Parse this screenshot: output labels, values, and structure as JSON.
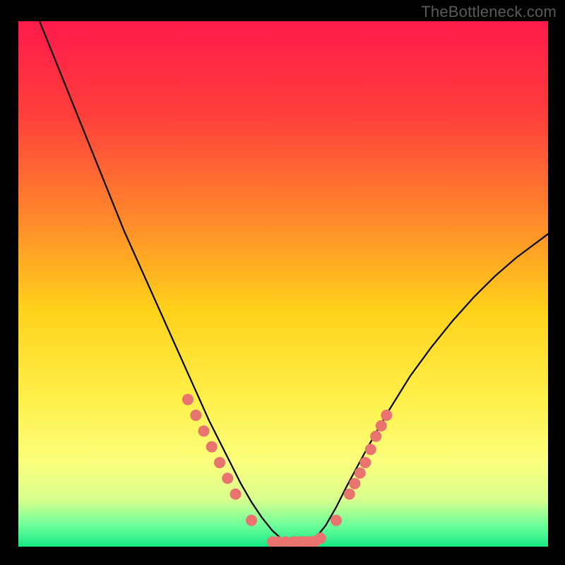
{
  "watermark": "TheBottleneck.com",
  "chart_data": {
    "type": "line",
    "title": "",
    "xlabel": "",
    "ylabel": "",
    "xlim": [
      0,
      100
    ],
    "ylim": [
      0,
      100
    ],
    "gradient_stops": [
      {
        "offset": 0,
        "color": "#ff1a4b"
      },
      {
        "offset": 18,
        "color": "#ff3f3c"
      },
      {
        "offset": 38,
        "color": "#ff8a2a"
      },
      {
        "offset": 55,
        "color": "#ffd21a"
      },
      {
        "offset": 72,
        "color": "#fff04a"
      },
      {
        "offset": 84,
        "color": "#fbff7d"
      },
      {
        "offset": 91,
        "color": "#d8ff8c"
      },
      {
        "offset": 96,
        "color": "#6cff9a"
      },
      {
        "offset": 100,
        "color": "#17e884"
      }
    ],
    "series": [
      {
        "name": "bottleneck-curve",
        "x": [
          0,
          4,
          8,
          12,
          16,
          20,
          24,
          28,
          32,
          36,
          38,
          40,
          42,
          44,
          46,
          48,
          50,
          52,
          54,
          56,
          58,
          60,
          62,
          66,
          70,
          74,
          78,
          82,
          86,
          90,
          94,
          98,
          100
        ],
        "values": [
          110,
          100,
          90,
          80,
          70,
          60,
          51,
          42,
          33,
          24,
          20,
          16,
          12,
          8.5,
          5.5,
          3.0,
          1.2,
          0.3,
          0.3,
          1.5,
          4.0,
          7.5,
          11.5,
          19,
          26,
          32.5,
          38,
          43,
          47.5,
          51.5,
          55,
          58,
          59.5
        ]
      }
    ],
    "markers": {
      "name": "highlight-points",
      "color": "#e9736e",
      "radius": 8,
      "points": [
        {
          "x": 32.0,
          "y": 28.0
        },
        {
          "x": 33.5,
          "y": 25.0
        },
        {
          "x": 35.0,
          "y": 22.0
        },
        {
          "x": 36.5,
          "y": 19.0
        },
        {
          "x": 38.0,
          "y": 16.0
        },
        {
          "x": 39.5,
          "y": 13.0
        },
        {
          "x": 41.0,
          "y": 10.0
        },
        {
          "x": 44.0,
          "y": 5.0
        },
        {
          "x": 48.0,
          "y": 0.9
        },
        {
          "x": 49.0,
          "y": 0.9
        },
        {
          "x": 50.5,
          "y": 0.9
        },
        {
          "x": 52.0,
          "y": 0.9
        },
        {
          "x": 53.0,
          "y": 0.9
        },
        {
          "x": 54.0,
          "y": 0.9
        },
        {
          "x": 55.0,
          "y": 0.9
        },
        {
          "x": 56.0,
          "y": 1.0
        },
        {
          "x": 57.0,
          "y": 1.6
        },
        {
          "x": 60.0,
          "y": 5.0
        },
        {
          "x": 62.5,
          "y": 10.0
        },
        {
          "x": 63.5,
          "y": 12.0
        },
        {
          "x": 64.5,
          "y": 14.0
        },
        {
          "x": 65.5,
          "y": 16.0
        },
        {
          "x": 66.5,
          "y": 18.5
        },
        {
          "x": 67.5,
          "y": 21.0
        },
        {
          "x": 68.5,
          "y": 23.0
        },
        {
          "x": 69.5,
          "y": 25.0
        }
      ]
    }
  }
}
